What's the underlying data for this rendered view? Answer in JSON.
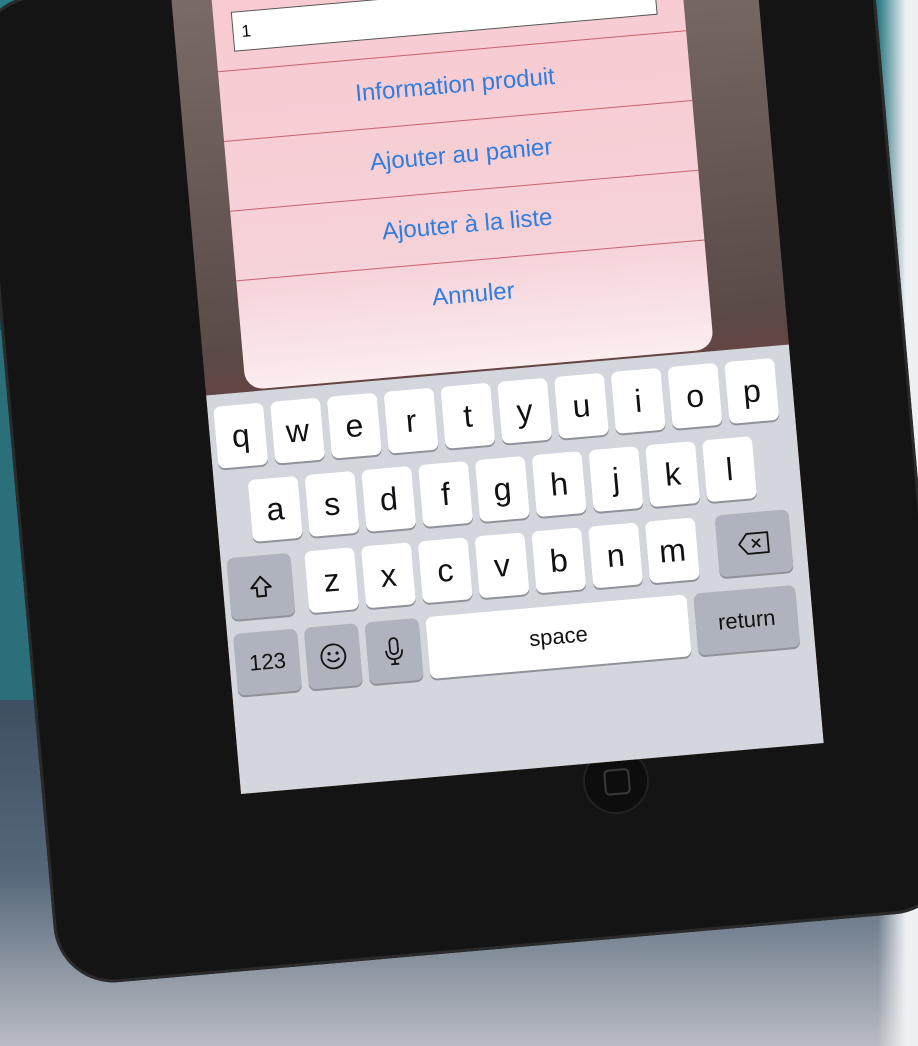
{
  "alert": {
    "quantity_value": "1",
    "buttons": [
      "Information produit",
      "Ajouter au panier",
      "Ajouter à la liste",
      "Annuler"
    ]
  },
  "keyboard": {
    "row1": [
      "q",
      "w",
      "e",
      "r",
      "t",
      "y",
      "u",
      "i",
      "o",
      "p"
    ],
    "row2": [
      "a",
      "s",
      "d",
      "f",
      "g",
      "h",
      "j",
      "k",
      "l"
    ],
    "row3": [
      "z",
      "x",
      "c",
      "v",
      "b",
      "n",
      "m"
    ],
    "shift_icon": "shift-icon",
    "delete_icon": "delete-icon",
    "numbers_label": "123",
    "emoji_icon": "emoji-icon",
    "mic_icon": "microphone-icon",
    "space_label": "space",
    "return_label": "return"
  },
  "colors": {
    "alert_button_text": "#2f7de0",
    "alert_background": "#fccdd4",
    "keyboard_background": "#d3d6dc"
  }
}
